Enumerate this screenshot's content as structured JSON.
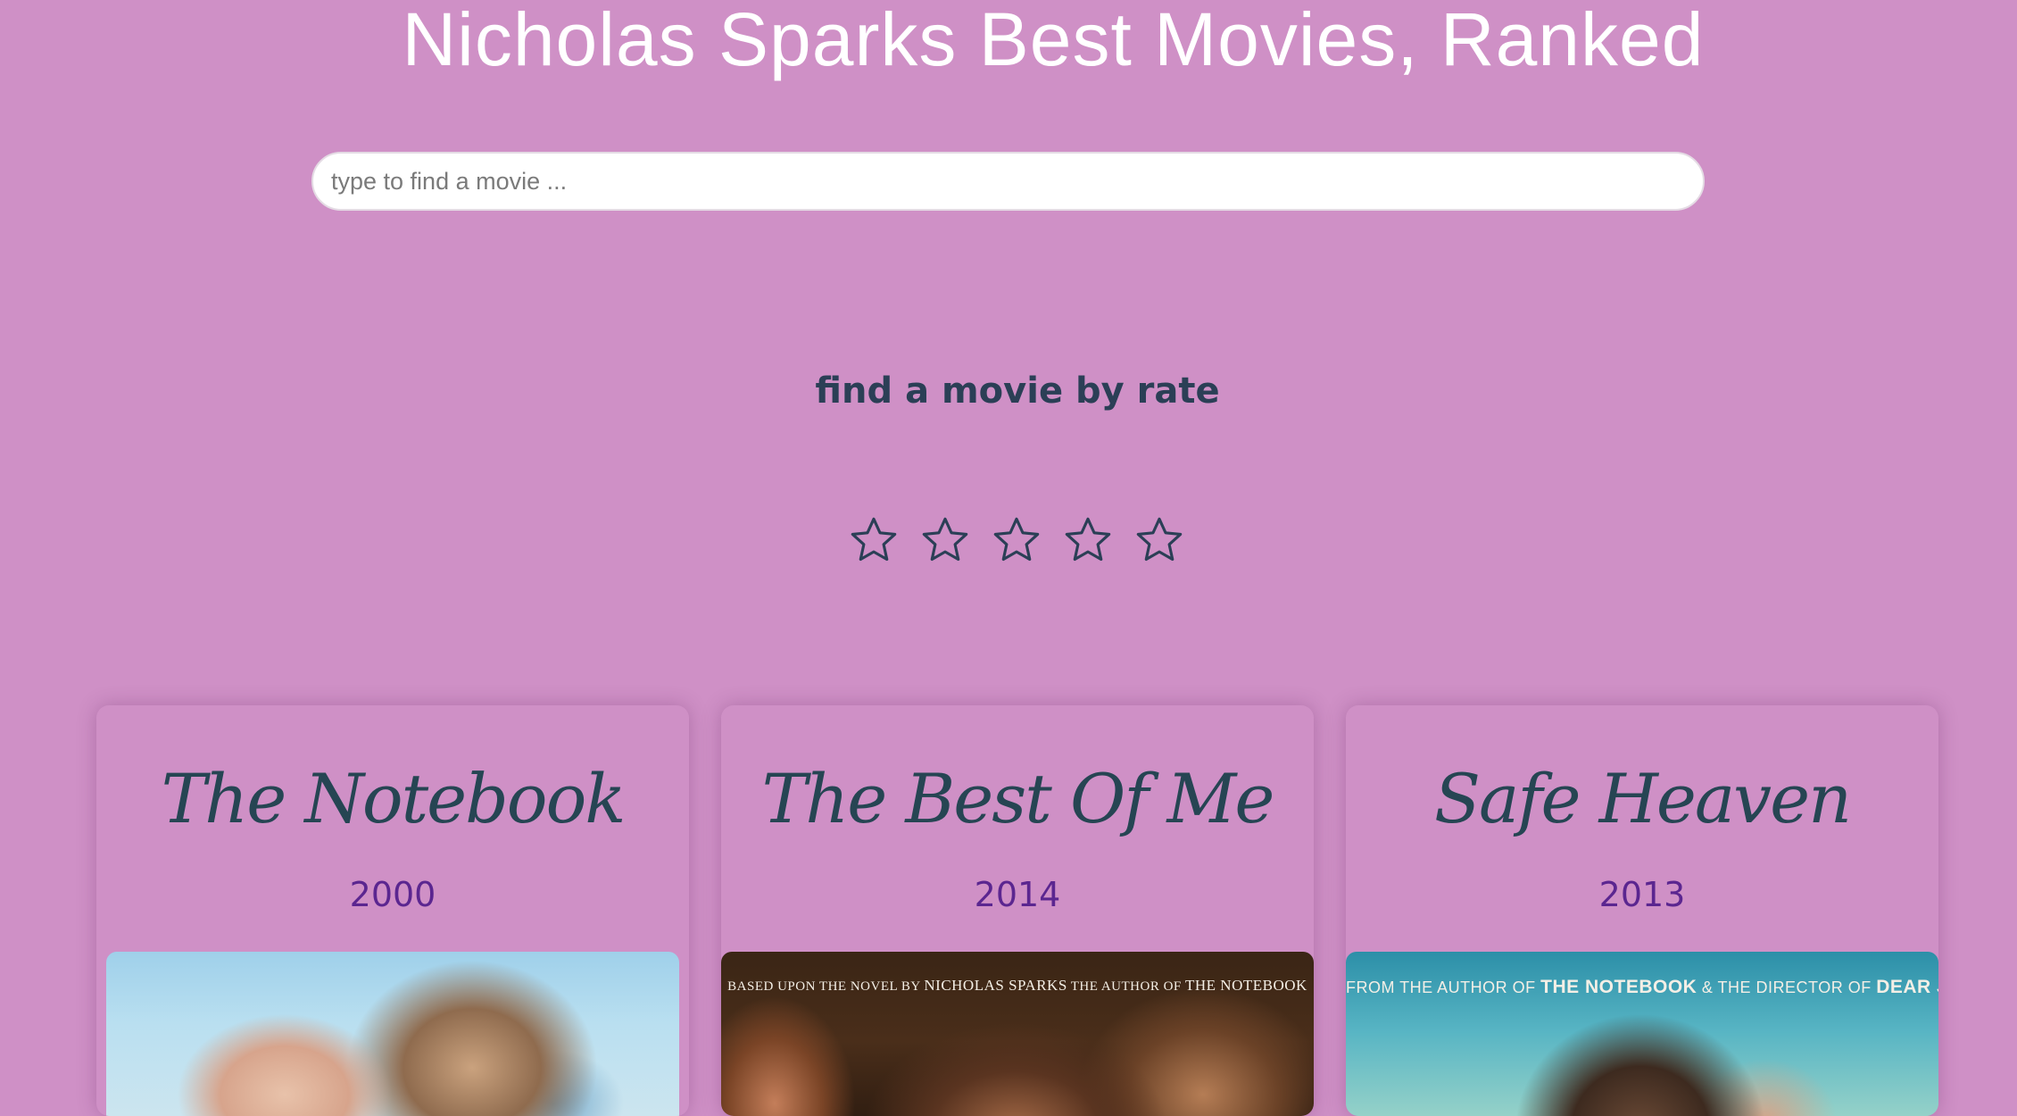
{
  "header": {
    "title": "Nicholas Sparks Best Movies, Ranked"
  },
  "search": {
    "placeholder": "type to find a movie ...",
    "value": ""
  },
  "rating_filter": {
    "heading": "find a movie by rate",
    "max_stars": 5,
    "selected_stars": 0,
    "icon": "star-outline-icon",
    "star_color": "#2b3f56"
  },
  "movies": [
    {
      "title": "The Notebook",
      "year": "2000",
      "poster_caption": null
    },
    {
      "title": "The Best Of Me",
      "year": "2014",
      "poster_caption": {
        "prefix": "BASED UPON THE NOVEL BY ",
        "author": "NICHOLAS SPARKS",
        "middle": " THE AUTHOR OF ",
        "work": "THE NOTEBOOK"
      }
    },
    {
      "title": "Safe Heaven",
      "year": "2013",
      "poster_caption": {
        "prefix": "FROM THE AUTHOR OF ",
        "work": "THE NOTEBOOK",
        "middle": " & THE DIRECTOR OF ",
        "work2": "DEAR JOHN"
      }
    }
  ],
  "colors": {
    "background": "#cf90c6",
    "title_text": "#ffffff",
    "heading_text": "#2b3f56",
    "card_title": "#264553",
    "year_text": "#5b2690"
  }
}
